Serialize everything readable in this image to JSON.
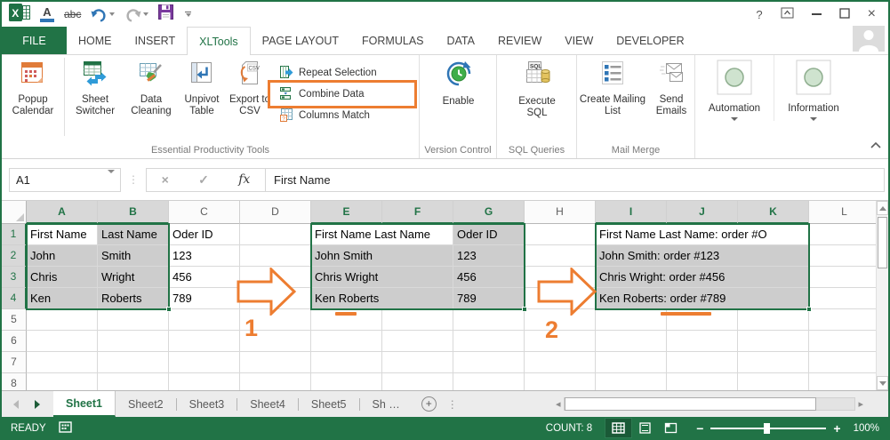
{
  "colors": {
    "excel_green": "#217346",
    "accent_orange": "#ED7D31",
    "selection_gray": "#cdcdcd"
  },
  "titlebar": {
    "help": "?",
    "close": "×"
  },
  "qat": {
    "font_color_letter": "A",
    "strikethrough_text": "abc",
    "excel_logo_letter": "X"
  },
  "tabs": [
    {
      "label": "FILE"
    },
    {
      "label": "HOME"
    },
    {
      "label": "INSERT"
    },
    {
      "label": "XLTools"
    },
    {
      "label": "PAGE LAYOUT"
    },
    {
      "label": "FORMULAS"
    },
    {
      "label": "DATA"
    },
    {
      "label": "REVIEW"
    },
    {
      "label": "VIEW"
    },
    {
      "label": "DEVELOPER"
    }
  ],
  "ribbon": {
    "groups": [
      {
        "label": "Essential Productivity Tools",
        "big": [
          {
            "label": "Popup Calendar"
          },
          {
            "label": "Sheet Switcher"
          },
          {
            "label": "Data Cleaning"
          },
          {
            "label": "Unpivot Table"
          },
          {
            "label": "Export to CSV"
          }
        ],
        "small": [
          {
            "label": "Repeat Selection"
          },
          {
            "label": "Combine Data",
            "highlighted": true
          },
          {
            "label": "Columns Match"
          }
        ]
      },
      {
        "label": "Version Control",
        "big": [
          {
            "label": "Enable"
          }
        ]
      },
      {
        "label": "SQL Queries",
        "big": [
          {
            "label": "Execute SQL"
          }
        ]
      },
      {
        "label": "Mail Merge",
        "big": [
          {
            "label": "Create Mailing List"
          },
          {
            "label": "Send Emails"
          }
        ]
      },
      {
        "label": "",
        "big": [
          {
            "label": "Automation",
            "dropdown": true
          },
          {
            "label": "Information",
            "dropdown": true
          }
        ]
      }
    ],
    "icon_texts": {
      "csv": "CSV",
      "sql": "SQL",
      "question": "?"
    }
  },
  "formula_bar": {
    "name_box": "A1",
    "cancel": "×",
    "enter": "✓",
    "fx": "fx",
    "content": "First Name"
  },
  "grid": {
    "col_headers": [
      "A",
      "B",
      "C",
      "D",
      "E",
      "F",
      "G",
      "H",
      "I",
      "J",
      "K",
      "L"
    ],
    "row_headers": [
      "1",
      "2",
      "3",
      "4",
      "5",
      "6",
      "7",
      "8"
    ],
    "selected_cols": [
      0,
      1,
      4,
      5,
      6,
      8,
      9,
      10
    ],
    "selected_rows": [
      0,
      1,
      2,
      3
    ],
    "cells": [
      {
        "c": 0,
        "r": 0,
        "t": "First Name",
        "bg": "w"
      },
      {
        "c": 1,
        "r": 0,
        "t": "Last Name",
        "bg": "g"
      },
      {
        "c": 2,
        "r": 0,
        "t": "Oder ID",
        "bg": "w"
      },
      {
        "c": 0,
        "r": 1,
        "t": "John",
        "bg": "g"
      },
      {
        "c": 1,
        "r": 1,
        "t": "Smith",
        "bg": "g"
      },
      {
        "c": 2,
        "r": 1,
        "t": "123",
        "bg": "w"
      },
      {
        "c": 0,
        "r": 2,
        "t": "Chris",
        "bg": "g"
      },
      {
        "c": 1,
        "r": 2,
        "t": "Wright",
        "bg": "g"
      },
      {
        "c": 2,
        "r": 2,
        "t": "456",
        "bg": "w"
      },
      {
        "c": 0,
        "r": 3,
        "t": "Ken",
        "bg": "g"
      },
      {
        "c": 1,
        "r": 3,
        "t": "Roberts",
        "bg": "g"
      },
      {
        "c": 2,
        "r": 3,
        "t": "789",
        "bg": "w"
      },
      {
        "c": 4,
        "r": 0,
        "t": "First Name Last Name",
        "bg": "w",
        "span": 2
      },
      {
        "c": 6,
        "r": 0,
        "t": "Oder ID",
        "bg": "g"
      },
      {
        "c": 4,
        "r": 1,
        "t": "John Smith",
        "bg": "g",
        "span": 2
      },
      {
        "c": 6,
        "r": 1,
        "t": "123",
        "bg": "g"
      },
      {
        "c": 4,
        "r": 2,
        "t": "Chris Wright",
        "bg": "g",
        "span": 2
      },
      {
        "c": 6,
        "r": 2,
        "t": "456",
        "bg": "g"
      },
      {
        "c": 4,
        "r": 3,
        "t": "Ken Roberts",
        "bg": "g",
        "span": 2
      },
      {
        "c": 6,
        "r": 3,
        "t": "789",
        "bg": "g"
      },
      {
        "c": 8,
        "r": 0,
        "t": "First Name Last Name: order #O",
        "bg": "w",
        "span": 3
      },
      {
        "c": 8,
        "r": 1,
        "t": "John Smith: order #123",
        "bg": "g",
        "span": 3
      },
      {
        "c": 8,
        "r": 2,
        "t": "Chris Wright: order #456",
        "bg": "g",
        "span": 3
      },
      {
        "c": 8,
        "r": 3,
        "t": "Ken Roberts: order #789",
        "bg": "g",
        "span": 3
      }
    ],
    "selections": [
      {
        "c": 0,
        "r": 0,
        "w": 2,
        "h": 4
      },
      {
        "c": 4,
        "r": 0,
        "w": 3,
        "h": 4
      },
      {
        "c": 8,
        "r": 0,
        "w": 3,
        "h": 4
      }
    ]
  },
  "annotations": {
    "step1": "1",
    "step2": "2"
  },
  "sheet_tabs": {
    "tabs": [
      "Sheet1",
      "Sheet2",
      "Sheet3",
      "Sheet4",
      "Sheet5",
      "Sh …"
    ],
    "active": "Sheet1"
  },
  "status_bar": {
    "mode": "READY",
    "count_label": "COUNT: 8",
    "zoom_out": "−",
    "zoom_in": "+",
    "zoom_level": "100%"
  }
}
